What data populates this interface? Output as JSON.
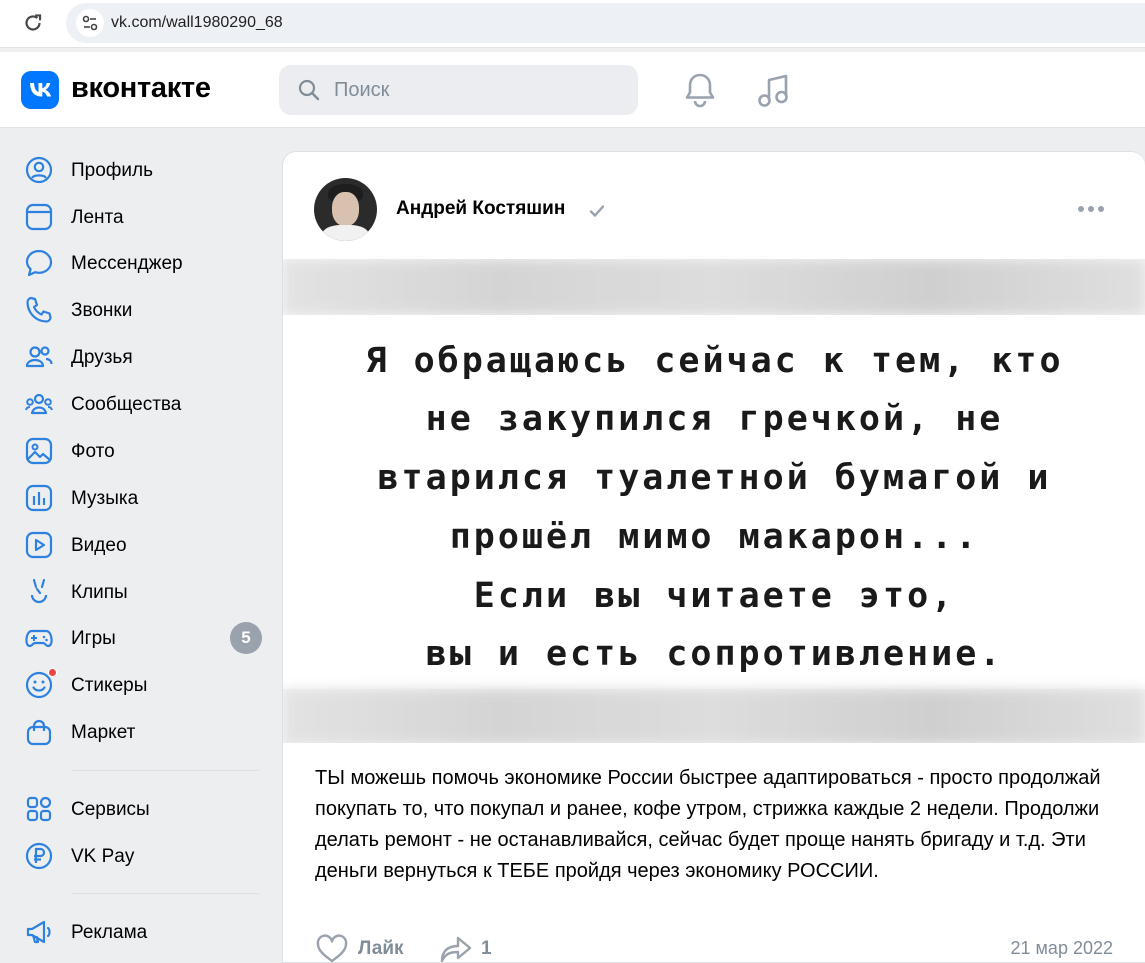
{
  "browser": {
    "url": "vk.com/wall1980290_68"
  },
  "header": {
    "brand": "вконтакте",
    "search_placeholder": "Поиск",
    "icons": [
      "bell-icon",
      "music-icon"
    ]
  },
  "sidebar": {
    "items": [
      {
        "label": "Профиль",
        "icon": "profile-icon"
      },
      {
        "label": "Лента",
        "icon": "feed-icon"
      },
      {
        "label": "Мессенджер",
        "icon": "messenger-icon"
      },
      {
        "label": "Звонки",
        "icon": "phone-icon"
      },
      {
        "label": "Друзья",
        "icon": "friends-icon"
      },
      {
        "label": "Сообщества",
        "icon": "communities-icon"
      },
      {
        "label": "Фото",
        "icon": "photo-icon"
      },
      {
        "label": "Музыка",
        "icon": "music-icon"
      },
      {
        "label": "Видео",
        "icon": "video-icon"
      },
      {
        "label": "Клипы",
        "icon": "clips-icon"
      },
      {
        "label": "Игры",
        "icon": "games-icon",
        "badge": "5"
      },
      {
        "label": "Стикеры",
        "icon": "stickers-icon"
      },
      {
        "label": "Маркет",
        "icon": "market-icon"
      },
      {
        "label": "Сервисы",
        "icon": "services-icon"
      },
      {
        "label": "VK Pay",
        "icon": "vkpay-icon"
      },
      {
        "label": "Реклама",
        "icon": "ads-icon"
      }
    ]
  },
  "post": {
    "author": "Андрей Костяшин",
    "image_lines": [
      "Я обращаюсь сейчас к тем, кто",
      "не закупился гречкой, не",
      "втарился туалетной бумагой и",
      "прошёл мимо макарон...",
      "Если вы читаете это,",
      "вы и есть сопротивление."
    ],
    "text": "ТЫ можешь помочь экономике России быстрее адаптироваться - просто продолжай покупать то, что покупал и ранее, кофе утром, стрижка каждые 2 недели. Продолжи делать ремонт - не останавливайся, сейчас будет проще нанять бригаду и т.д. Эти деньги вернуться к ТЕБЕ пройдя через экономику РОССИИ.",
    "like_label": "Лайк",
    "share_count": "1",
    "date": "21 мар 2022"
  },
  "colors": {
    "accent": "#0077ff",
    "icon_blue": "#2d81e0",
    "secondary_text": "#818c99",
    "badge": "#99a2ad",
    "notification_dot": "#e64646"
  }
}
